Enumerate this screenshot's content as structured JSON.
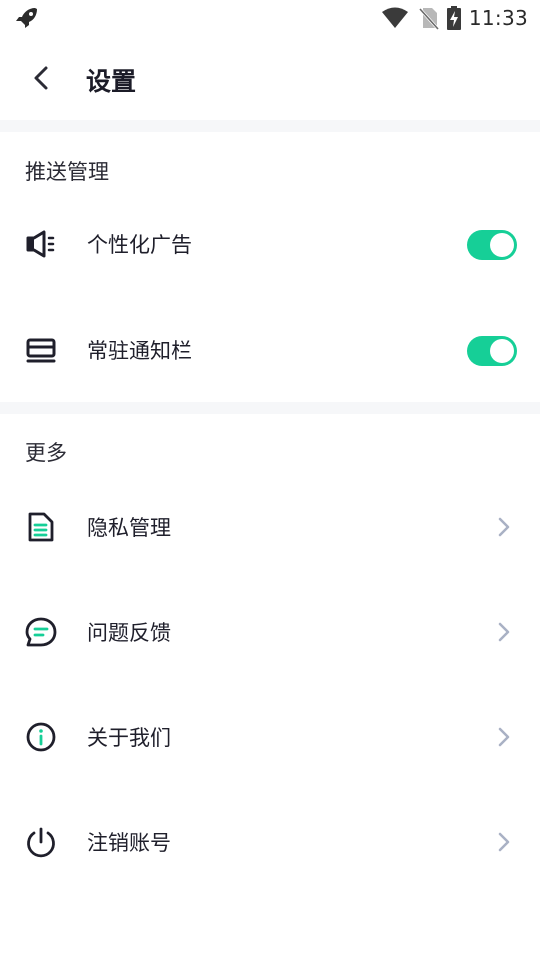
{
  "status_bar": {
    "time": "11:33",
    "icons": [
      "rocket-icon",
      "wifi-icon",
      "no-sim-icon",
      "battery-charging-icon"
    ]
  },
  "header": {
    "back_icon": "chevron-left-icon",
    "title": "设置"
  },
  "sections": {
    "push": {
      "title": "推送管理",
      "items": [
        {
          "label": "个性化广告",
          "icon": "megaphone-icon",
          "toggle_on": true
        },
        {
          "label": "常驻通知栏",
          "icon": "notification-bar-icon",
          "toggle_on": true
        }
      ]
    },
    "more": {
      "title": "更多",
      "items": [
        {
          "label": "隐私管理",
          "icon": "document-icon"
        },
        {
          "label": "问题反馈",
          "icon": "chat-bubble-icon"
        },
        {
          "label": "关于我们",
          "icon": "info-icon"
        },
        {
          "label": "注销账号",
          "icon": "power-icon"
        }
      ]
    }
  },
  "colors": {
    "accent": "#16cf97",
    "text": "#1f1f2b",
    "chevron": "#a9b1c4",
    "divider": "#f6f7f9"
  }
}
